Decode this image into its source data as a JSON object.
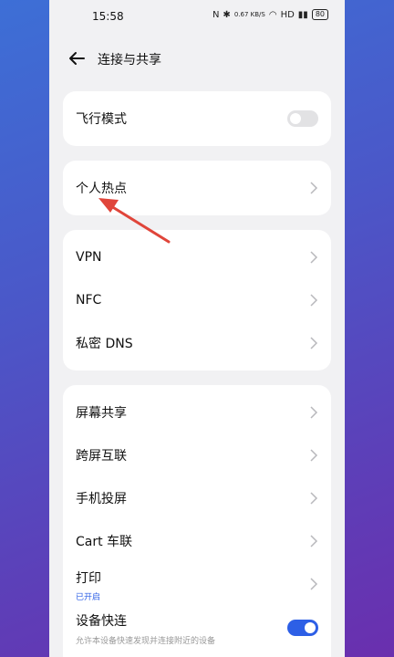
{
  "status": {
    "time": "15:58",
    "net_speed": "0.67 KB/S",
    "battery": "80"
  },
  "header": {
    "title": "连接与共享"
  },
  "card_airplane": {
    "label": "飞行模式"
  },
  "card_hotspot": {
    "label": "个人热点"
  },
  "card_network": {
    "items": [
      "VPN",
      "NFC",
      "私密 DNS"
    ]
  },
  "card_share": {
    "items": [
      "屏幕共享",
      "跨屏互联",
      "手机投屏",
      "Cart 车联"
    ],
    "print_label": "打印",
    "print_status": "已开启",
    "fast_connect_label": "设备快连",
    "fast_connect_desc": "允许本设备快速发现并连接附近的设备"
  },
  "colors": {
    "accent": "#2d5fe6",
    "annotation_arrow": "#e0453a"
  }
}
